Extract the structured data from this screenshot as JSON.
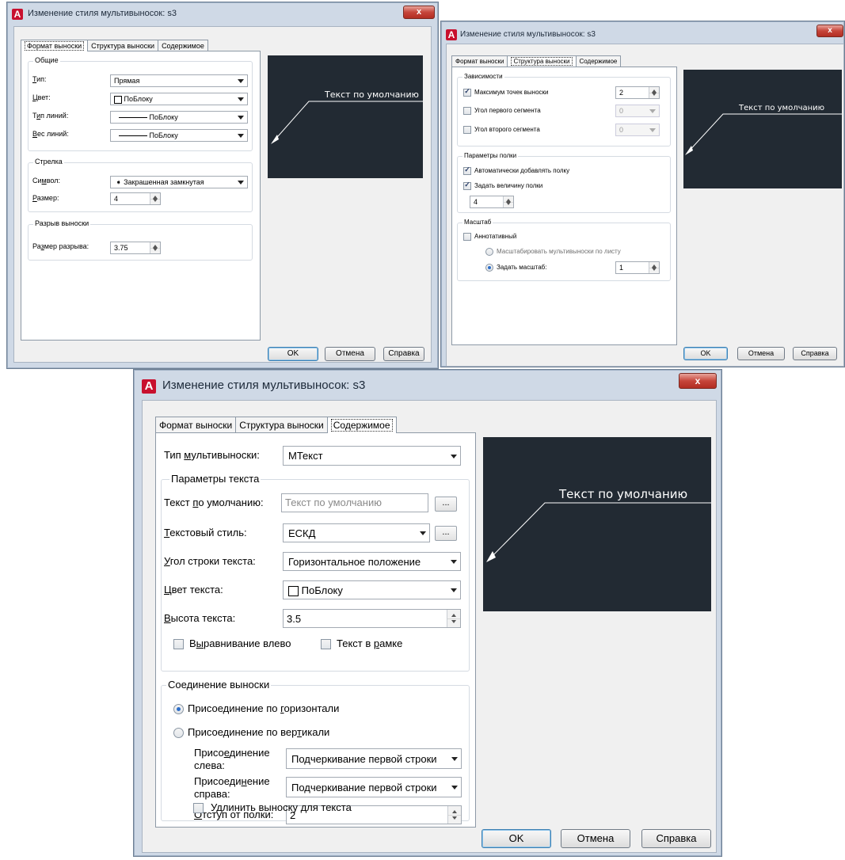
{
  "window_title": "Изменение стиля мультивыносок: s3",
  "close_label": "x",
  "tabs": [
    "Формат выноски",
    "Структура выноски",
    "Содержимое"
  ],
  "buttons": {
    "ok": "OK",
    "cancel": "Отмена",
    "help": "Справка"
  },
  "preview_text": "Текст по умолчанию",
  "ellipsis": "...",
  "dialog1": {
    "general": {
      "title": "Общие",
      "type_label": "Тип:",
      "type_value": "Прямая",
      "color_label": "Цвет:",
      "color_value": "ПоБлоку",
      "linetype_label": "Тип линий:",
      "linetype_value": "ПоБлоку",
      "lineweight_label": "Вес линий:",
      "lineweight_value": "ПоБлоку"
    },
    "arrow": {
      "title": "Стрелка",
      "symbol_label": "Символ:",
      "symbol_value": "Закрашенная замкнутая",
      "size_label": "Размер:",
      "size_value": "4"
    },
    "break": {
      "title": "Разрыв выноски",
      "size_label": "Размер разрыва:",
      "size_value": "3.75"
    }
  },
  "dialog2": {
    "constraints": {
      "title": "Зависимости",
      "max_points_label": "Максимум точек выноски",
      "max_points_value": "2",
      "max_points_checked": true,
      "first_angle_label": "Угол первого сегмента",
      "first_angle_value": "0",
      "first_angle_checked": false,
      "second_angle_label": "Угол второго сегмента",
      "second_angle_value": "0",
      "second_angle_checked": false
    },
    "landing": {
      "title": "Параметры полки",
      "auto_label": "Автоматически добавлять полку",
      "auto_checked": true,
      "set_distance_label": "Задать величину полки",
      "set_distance_checked": true,
      "distance_value": "4"
    },
    "scale": {
      "title": "Масштаб",
      "annotative_label": "Аннотативный",
      "annotative_checked": false,
      "scale_to_layout_label": "Масштабировать мультивыноски по листу",
      "specify_scale_label": "Задать масштаб:",
      "specify_scale_value": "1"
    }
  },
  "dialog3": {
    "mleader_type_label": "Тип мультивыноски:",
    "mleader_type_value": "МТекст",
    "text_options": {
      "title": "Параметры текста",
      "default_text_label": "Текст по умолчанию:",
      "default_text_value": "Текст по умолчанию",
      "text_style_label": "Текстовый стиль:",
      "text_style_value": "ЕСКД",
      "text_angle_label": "Угол строки текста:",
      "text_angle_value": "Горизонтальное положение",
      "text_color_label": "Цвет текста:",
      "text_color_value": "ПоБлоку",
      "text_height_label": "Высота текста:",
      "text_height_value": "3.5",
      "left_justify_label": "Выравнивание влево",
      "left_justify_checked": false,
      "frame_text_label": "Текст в рамке",
      "frame_text_checked": false
    },
    "leader_connection": {
      "title": "Соединение выноски",
      "horizontal_label": "Присоединение по горизонтали",
      "horizontal_selected": true,
      "vertical_label": "Присоединение по вертикали",
      "vertical_selected": false,
      "left_attach_label_1": "Присоединение",
      "left_attach_label_2": "слева:",
      "left_attach_value": "Подчеркивание первой строки",
      "right_attach_label_1": "Присоединение",
      "right_attach_label_2": "справа:",
      "right_attach_value": "Подчеркивание первой строки",
      "landing_gap_label": "Отступ от полки:",
      "landing_gap_value": "2",
      "extend_label": "Удлинить выноску для текста",
      "extend_checked": false
    }
  },
  "colors": {
    "preview_bg": "#222a33",
    "preview_line": "#ffffff",
    "close_button": "#c6453a",
    "app_logo": "#c8102e"
  }
}
